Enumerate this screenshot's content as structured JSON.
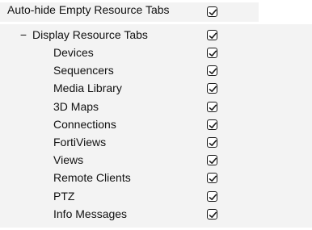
{
  "settings": {
    "auto_hide": {
      "label": "Auto-hide Empty Resource Tabs",
      "checked": true
    },
    "display_tabs": {
      "collapse_symbol": "−",
      "label": "Display Resource Tabs",
      "checked": true,
      "items": [
        {
          "label": "Devices",
          "checked": true
        },
        {
          "label": "Sequencers",
          "checked": true
        },
        {
          "label": "Media Library",
          "checked": true
        },
        {
          "label": "3D Maps",
          "checked": true
        },
        {
          "label": "Connections",
          "checked": true
        },
        {
          "label": "FortiViews",
          "checked": true
        },
        {
          "label": "Views",
          "checked": true
        },
        {
          "label": "Remote Clients",
          "checked": true
        },
        {
          "label": "PTZ",
          "checked": true
        },
        {
          "label": "Info Messages",
          "checked": true
        }
      ]
    }
  }
}
